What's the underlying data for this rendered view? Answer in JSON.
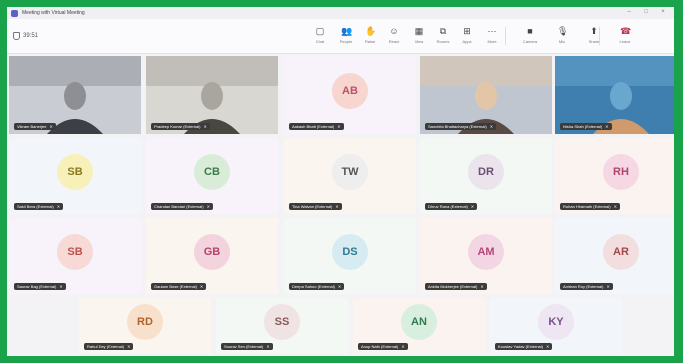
{
  "window": {
    "title": "Meeting with Virtual Meeting",
    "timer": "39:51",
    "controls": [
      "–",
      "□",
      "×"
    ]
  },
  "toolbar": {
    "buttons": [
      {
        "label": "Chat",
        "icon": "chat-icon",
        "glyph": "▢"
      },
      {
        "label": "People",
        "icon": "people-icon",
        "glyph": "👥"
      },
      {
        "label": "Raise",
        "icon": "raise-hand-icon",
        "glyph": "✋"
      },
      {
        "label": "React",
        "icon": "react-icon",
        "glyph": "☺"
      },
      {
        "label": "View",
        "icon": "view-icon",
        "glyph": "▦"
      },
      {
        "label": "Rooms",
        "icon": "rooms-icon",
        "glyph": "⧉"
      },
      {
        "label": "Apps",
        "icon": "apps-icon",
        "glyph": "⊞"
      },
      {
        "label": "More",
        "icon": "more-icon",
        "glyph": "⋯"
      },
      {
        "label": "Camera",
        "icon": "camera-icon",
        "glyph": "■"
      },
      {
        "label": "Mic",
        "icon": "mic-icon",
        "glyph": "🎙"
      },
      {
        "label": "Share",
        "icon": "share-icon",
        "glyph": "⬆"
      },
      {
        "label": "Leave",
        "icon": "leave-phone-icon",
        "glyph": "☎"
      }
    ]
  },
  "participants": [
    {
      "name": "Vikram Banerjee",
      "initials": "",
      "video": true
    },
    {
      "name": "Pradeep Kumar (External)",
      "initials": "",
      "video": true
    },
    {
      "name": "Aakash Bhatt (External)",
      "initials": "AB",
      "avatar_color": "#f6d6cf",
      "text_color": "#c0506a"
    },
    {
      "name": "Sanchita Bhattacharya (External)",
      "initials": "",
      "video": true
    },
    {
      "name": "Nisha Shah (External)",
      "initials": "",
      "video": true
    },
    {
      "name": "Sakil Bera (External)",
      "initials": "SB",
      "avatar_color": "#f7f0b8",
      "text_color": "#8a7a1b"
    },
    {
      "name": "Chandan Bandari (External)",
      "initials": "CB",
      "avatar_color": "#d8ecd8",
      "text_color": "#3d7a4a"
    },
    {
      "name": "Tina Walvan (External)",
      "initials": "TW",
      "avatar_color": "#eeeeee",
      "text_color": "#555555"
    },
    {
      "name": "Dhruv Rana (External)",
      "initials": "DR",
      "avatar_color": "#ebe4ec",
      "text_color": "#6d4f72"
    },
    {
      "name": "Rohan Hiramath (External)",
      "initials": "RH",
      "avatar_color": "#f5d8e4",
      "text_color": "#b0466e"
    },
    {
      "name": "Saurav Bag (External)",
      "initials": "SB",
      "avatar_color": "#f7d9d6",
      "text_color": "#c0504a"
    },
    {
      "name": "Gautam Bose (External)",
      "initials": "GB",
      "avatar_color": "#f3d3dd",
      "text_color": "#b54468"
    },
    {
      "name": "Deepa Sahoo (External)",
      "initials": "DS",
      "avatar_color": "#d6ecf2",
      "text_color": "#2f7a90"
    },
    {
      "name": "Ankita Mukherjee (External)",
      "initials": "AM",
      "avatar_color": "#f3d6e4",
      "text_color": "#b5467a"
    },
    {
      "name": "Anirban Roy (External)",
      "initials": "AR",
      "avatar_color": "#f2dede",
      "text_color": "#a04a4a"
    },
    {
      "name": "Rahul Dey (External)",
      "initials": "RD",
      "avatar_color": "#f8e1cc",
      "text_color": "#b0622a"
    },
    {
      "name": "Sourav Sen (External)",
      "initials": "SS",
      "avatar_color": "#efe3e3",
      "text_color": "#8a5a5a"
    },
    {
      "name": "Anup Nath (External)",
      "initials": "AN",
      "avatar_color": "#d8efdf",
      "text_color": "#2f7a4f"
    },
    {
      "name": "Koustav Yadav (External)",
      "initials": "KY",
      "avatar_color": "#efe6f3",
      "text_color": "#7a4f8a"
    }
  ]
}
